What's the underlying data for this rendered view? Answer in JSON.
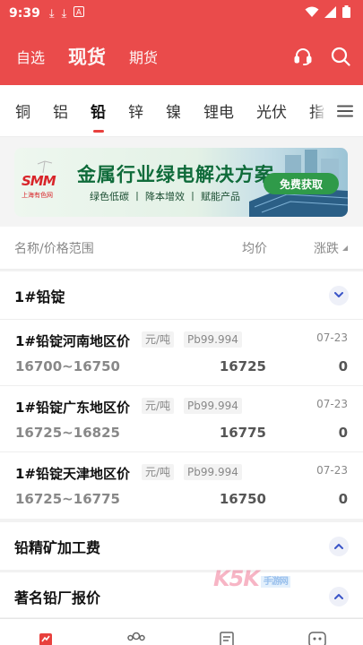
{
  "status_bar": {
    "time": "9:39",
    "icons": [
      "download-icon",
      "download-icon",
      "font-icon",
      "wifi-icon",
      "signal-icon",
      "battery-icon"
    ]
  },
  "header": {
    "tabs": [
      {
        "label": "自选"
      },
      {
        "label": "现货"
      },
      {
        "label": "期货"
      }
    ],
    "active_tab": "现货",
    "actions": [
      "headset-icon",
      "search-icon"
    ]
  },
  "metal_tabs": {
    "items": [
      {
        "label": "铜"
      },
      {
        "label": "铝"
      },
      {
        "label": "铅"
      },
      {
        "label": "锌"
      },
      {
        "label": "镍"
      },
      {
        "label": "锂电"
      },
      {
        "label": "光伏"
      },
      {
        "label": "指"
      }
    ],
    "active": "铅"
  },
  "banner": {
    "logo": "SMM",
    "logo_sub": "上海有色网",
    "title": "金属行业绿电解决方案",
    "subtitle": "绿色低碳 丨 降本增效 丨 赋能产品",
    "button": "免费获取"
  },
  "list_header": {
    "name_col": "名称/价格范围",
    "avg_col": "均价",
    "change_col": "涨跌"
  },
  "groups": [
    {
      "title": "1#铅锭",
      "expanded": true,
      "rows": [
        {
          "name": "1#铅锭河南地区价",
          "unit": "元/吨",
          "grade": "Pb99.994",
          "date": "07-23",
          "range": "16700~16750",
          "avg": "16725",
          "change": "0"
        },
        {
          "name": "1#铅锭广东地区价",
          "unit": "元/吨",
          "grade": "Pb99.994",
          "date": "07-23",
          "range": "16725~16825",
          "avg": "16775",
          "change": "0"
        },
        {
          "name": "1#铅锭天津地区价",
          "unit": "元/吨",
          "grade": "Pb99.994",
          "date": "07-23",
          "range": "16725~16775",
          "avg": "16750",
          "change": "0"
        }
      ]
    },
    {
      "title": "铅精矿加工费",
      "expanded": false
    },
    {
      "title": "著名铅厂报价",
      "expanded": false
    }
  ],
  "watermark": {
    "text": "K5K",
    "sub": "手游网"
  },
  "bottom_nav": [
    "market-icon",
    "community-icon",
    "news-icon",
    "chat-icon"
  ],
  "colors": {
    "brand_red": "#ea4b4b",
    "accent_blue": "#3b55c8",
    "banner_green": "#2f9a49"
  }
}
